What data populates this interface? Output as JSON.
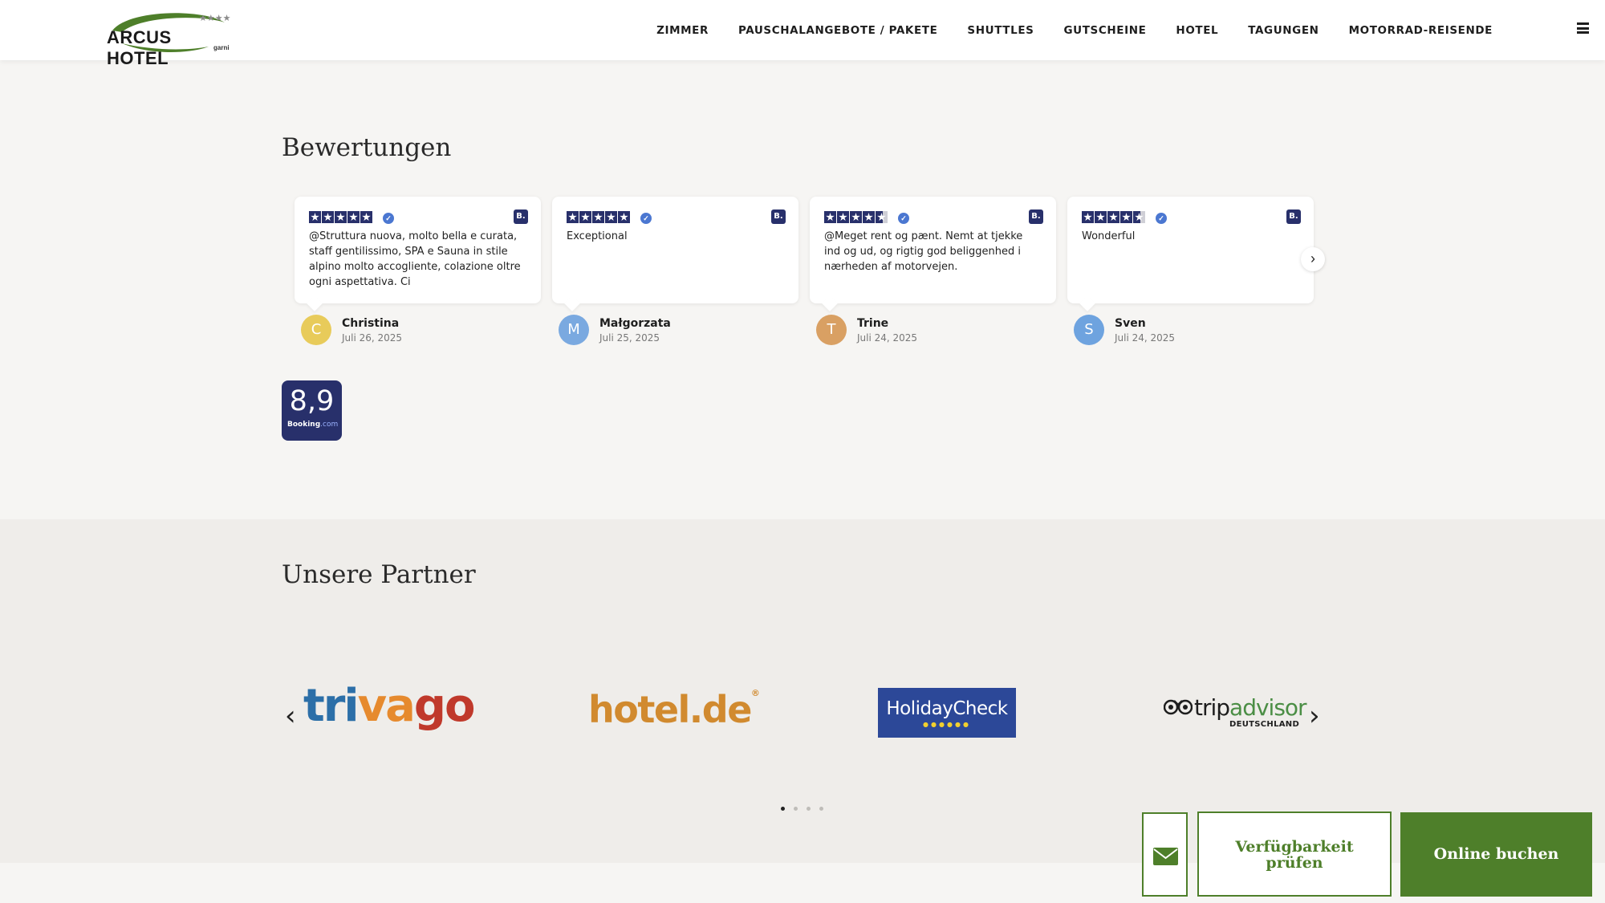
{
  "header": {
    "logo_text": "ARCUS HOTEL",
    "logo_stars": "★★★★",
    "logo_sub": "garni",
    "nav": [
      "ZIMMER",
      "PAUSCHALANGEBOTE / PAKETE",
      "SHUTTLES",
      "GUTSCHEINE",
      "HOTEL",
      "TAGUNGEN",
      "MOTORRAD-REISENDE"
    ]
  },
  "reviews": {
    "title": "Bewertungen",
    "items": [
      {
        "stars": 5,
        "text": "@Struttura nuova, molto bella e curata, staff gentilissimo, SPA e Sauna in stile alpino molto accogliente, colazione oltre ogni aspettativa. Ci",
        "name": "Christina",
        "date": "Juli 26, 2025",
        "initial": "C",
        "avatar_color": "#e8cb5a"
      },
      {
        "stars": 5,
        "text": "Exceptional",
        "name": "Małgorzata",
        "date": "Juli 25, 2025",
        "initial": "M",
        "avatar_color": "#7aa9e0"
      },
      {
        "stars": 4.5,
        "text": "@Meget rent og pænt. Nemt at tjekke ind og ud, og rigtig god beliggenhed i nærheden af motorvejen.",
        "name": "Trine",
        "date": "Juli 24, 2025",
        "initial": "T",
        "avatar_color": "#d9a063"
      },
      {
        "stars": 4.5,
        "text": "Wonderful",
        "name": "Sven",
        "date": "Juli 24, 2025",
        "initial": "S",
        "avatar_color": "#6ea3df"
      }
    ],
    "badge_letter": "B.",
    "score": "8,9",
    "score_brand": "Booking",
    "score_brand_suffix": ".com",
    "next_icon": "chevron-right-icon"
  },
  "partners": {
    "title": "Unsere Partner",
    "logos": {
      "trivago": [
        "tri",
        "va",
        "go"
      ],
      "hotelde": "hotel.de",
      "hotelde_reg": "®",
      "holidaycheck": "HolidayCheck",
      "holidaycheck_dots": "●●●●●●",
      "trip": "trip",
      "advisor": "advisor",
      "ta_sub": "DEUTSCHLAND"
    },
    "prev_arrow": "‹",
    "next_arrow": "›",
    "page_count": 4,
    "active_page": 1
  },
  "actions": {
    "mail_icon": "mail-icon",
    "avail_line1": "Verfügbarkeit",
    "avail_line2": "prüfen",
    "book": "Online buchen"
  },
  "colors": {
    "brand_green": "#4e7f2a",
    "booking_blue": "#28306b"
  }
}
